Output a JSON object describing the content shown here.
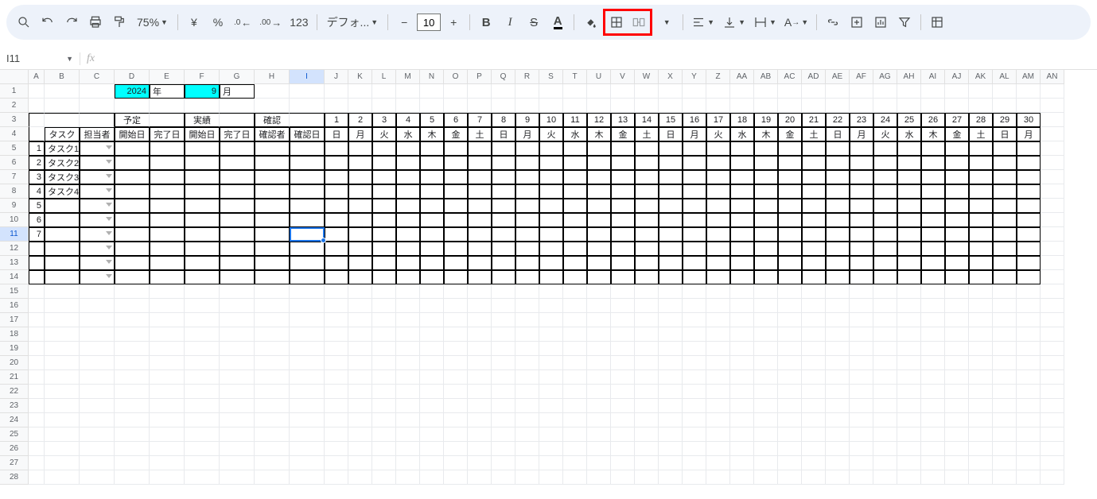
{
  "toolbar": {
    "zoom": "75%",
    "currency": "¥",
    "percent": "%",
    "dec_dec": ".0",
    "inc_dec": ".00",
    "num_format": "123",
    "font_name": "デフォ...",
    "font_size": "10"
  },
  "namebox": "I11",
  "formula": "",
  "columns": [
    "A",
    "B",
    "C",
    "D",
    "E",
    "F",
    "G",
    "H",
    "I",
    "J",
    "K",
    "L",
    "M",
    "N",
    "O",
    "P",
    "Q",
    "R",
    "S",
    "T",
    "U",
    "V",
    "W",
    "X",
    "Y",
    "Z",
    "AA",
    "AB",
    "AC",
    "AD",
    "AE",
    "AF",
    "AG",
    "AH",
    "AI",
    "AJ",
    "AK",
    "AL",
    "AM",
    "AN"
  ],
  "col_widths": {
    "A": 20,
    "B": 44,
    "C": 44,
    "D": 44,
    "E": 44,
    "F": 44,
    "G": 44,
    "H": 44,
    "I": 44,
    "default": 30
  },
  "rows": 28,
  "selected_cell": {
    "row": 11,
    "col": "I"
  },
  "data": {
    "year_value": "2024",
    "year_label": "年",
    "month_value": "9",
    "month_label": "月",
    "header_yotei": "予定",
    "header_jisseki": "実績",
    "header_kakunin": "確認",
    "sub_task": "タスク",
    "sub_tantou": "担当者",
    "sub_kaishi": "開始日",
    "sub_kanryou": "完了日",
    "sub_kakuninsya": "確認者",
    "sub_kakuninbi": "確認日",
    "days": [
      "1",
      "2",
      "3",
      "4",
      "5",
      "6",
      "7",
      "8",
      "9",
      "10",
      "11",
      "12",
      "13",
      "14",
      "15",
      "16",
      "17",
      "18",
      "19",
      "20",
      "21",
      "22",
      "23",
      "24",
      "25",
      "26",
      "27",
      "28",
      "29",
      "30"
    ],
    "weekdays": [
      "日",
      "月",
      "火",
      "水",
      "木",
      "金",
      "土",
      "日",
      "月",
      "火",
      "水",
      "木",
      "金",
      "土",
      "日",
      "月",
      "火",
      "水",
      "木",
      "金",
      "土",
      "日",
      "月",
      "火",
      "水",
      "木",
      "金",
      "土",
      "日",
      "月"
    ],
    "tasks": [
      {
        "n": "1",
        "name": "タスク1"
      },
      {
        "n": "2",
        "name": "タスク2"
      },
      {
        "n": "3",
        "name": "タスク3"
      },
      {
        "n": "4",
        "name": "タスク4"
      },
      {
        "n": "5",
        "name": ""
      },
      {
        "n": "6",
        "name": ""
      },
      {
        "n": "7",
        "name": ""
      }
    ]
  }
}
